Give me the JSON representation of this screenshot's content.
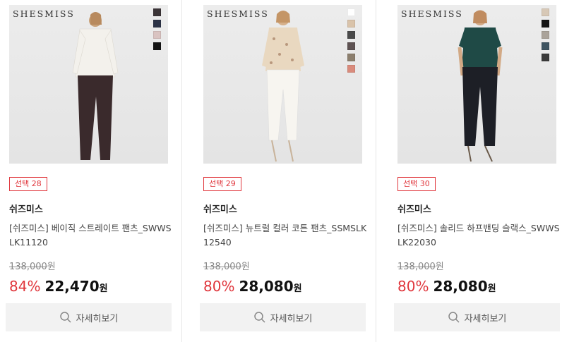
{
  "products": [
    {
      "brand_logo": "SHESMISS",
      "badge": "선택 28",
      "seller": "쉬즈미스",
      "name": "[쉬즈미스] 베이직 스트레이트 팬츠_SWWSLK11120",
      "original_price": "138,000",
      "original_currency": "원",
      "discount_rate": "84%",
      "price": "22,470",
      "currency": "원",
      "button_label": "자세히보기",
      "swatch_colors": [
        "#3b3437",
        "#2c3347",
        "#d9c3c1",
        "#141414"
      ],
      "top_color": "#f3f1ec",
      "pants_color": "#3a2a2c"
    },
    {
      "brand_logo": "SHESMISS",
      "badge": "선택 29",
      "seller": "쉬즈미스",
      "name": "[쉬즈미스] 뉴트럴 컬러 코튼 팬츠_SSMSLK12540",
      "original_price": "138,000",
      "original_currency": "원",
      "discount_rate": "80%",
      "price": "28,080",
      "currency": "원",
      "button_label": "자세히보기",
      "swatch_colors": [
        "#ffffff",
        "#d9c3aa",
        "#4a4a4a",
        "#5e5252",
        "#8c7f6e",
        "#d98b7c"
      ],
      "top_color": "#e9d8c0",
      "pants_color": "#f7f5f0"
    },
    {
      "brand_logo": "SHESMISS",
      "badge": "선택 30",
      "seller": "쉬즈미스",
      "name": "[쉬즈미스] 솔리드 하프밴딩 슬랙스_SWWSLK22030",
      "original_price": "138,000",
      "original_currency": "원",
      "discount_rate": "80%",
      "price": "28,080",
      "currency": "원",
      "button_label": "자세히보기",
      "swatch_colors": [
        "#d7c8b6",
        "#141414",
        "#aaa39a",
        "#3e5461",
        "#3a3a3a"
      ],
      "top_color": "#1f4a46",
      "pants_color": "#1d1f26"
    }
  ],
  "colors": {
    "accent": "#e0363c",
    "button_bg": "#f2f2f2"
  }
}
